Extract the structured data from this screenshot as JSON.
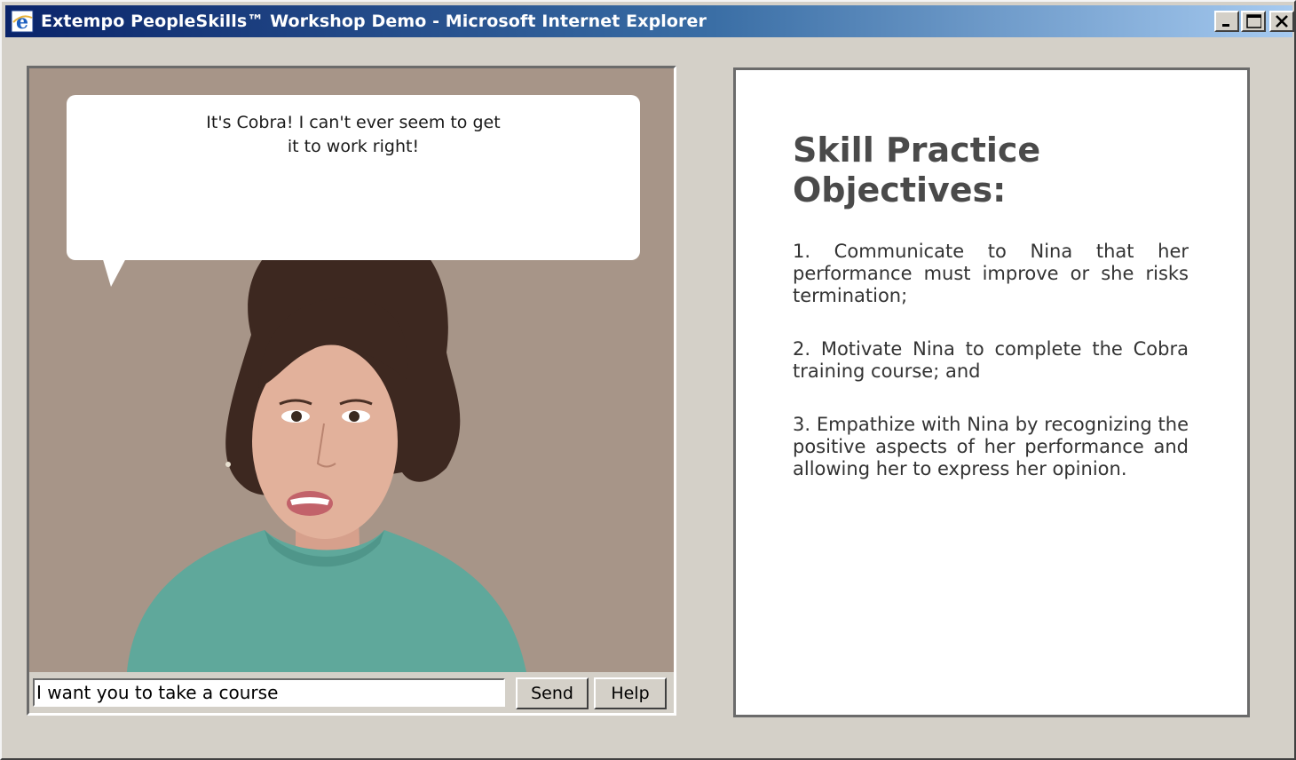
{
  "window": {
    "title": "Extempo PeopleSkills™ Workshop Demo - Microsoft Internet Explorer",
    "icon": "internet-explorer-icon",
    "controls": [
      "minimize-icon",
      "maximize-icon",
      "close-icon"
    ]
  },
  "conversation": {
    "speech_bubble": "It's Cobra! I can't ever seem to get it to work right!",
    "input_value": "I want you to take a course",
    "send_label": "Send",
    "help_label": "Help"
  },
  "objectives": {
    "title": "Skill Practice Objectives:",
    "items": [
      "1. Communicate to Nina that her performance must improve or she risks termination;",
      "2. Motivate Nina to complete the Cobra training course; and",
      "3. Empathize with Nina by recognizing the positive aspects of her performance and allowing her to express her opinion."
    ]
  },
  "colors": {
    "title_bar_start": "#0a246a",
    "title_bar_end": "#a6caf0",
    "window_face": "#d4d0c8",
    "video_background": "#a79588",
    "sweater": "#5fa89b",
    "objectives_title": "#4a4a4a"
  }
}
